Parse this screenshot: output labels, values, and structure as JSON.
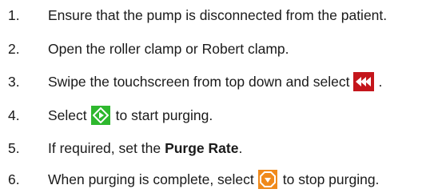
{
  "steps": [
    {
      "number": "1.",
      "text": "Ensure that the pump is disconnected from the patient."
    },
    {
      "number": "2.",
      "text": "Open the roller clamp or Robert clamp."
    },
    {
      "number": "3.",
      "text_before": "Swipe the touchscreen from top down and select",
      "icon": "rewind-purge-icon",
      "text_after": "."
    },
    {
      "number": "4.",
      "text_before": "Select",
      "icon": "start-diamond-icon",
      "text_after": "to start purging."
    },
    {
      "number": "5.",
      "text_before": "If required, set the",
      "bold": "Purge Rate",
      "text_after": "."
    },
    {
      "number": "6.",
      "text_before": "When purging is complete, select",
      "icon": "stop-octagon-icon",
      "text_after": "to stop purging."
    }
  ],
  "colors": {
    "rewind_icon_bg": "#c4161c",
    "start_icon_bg": "#2eb82e",
    "stop_icon_bg": "#f08a1c"
  }
}
